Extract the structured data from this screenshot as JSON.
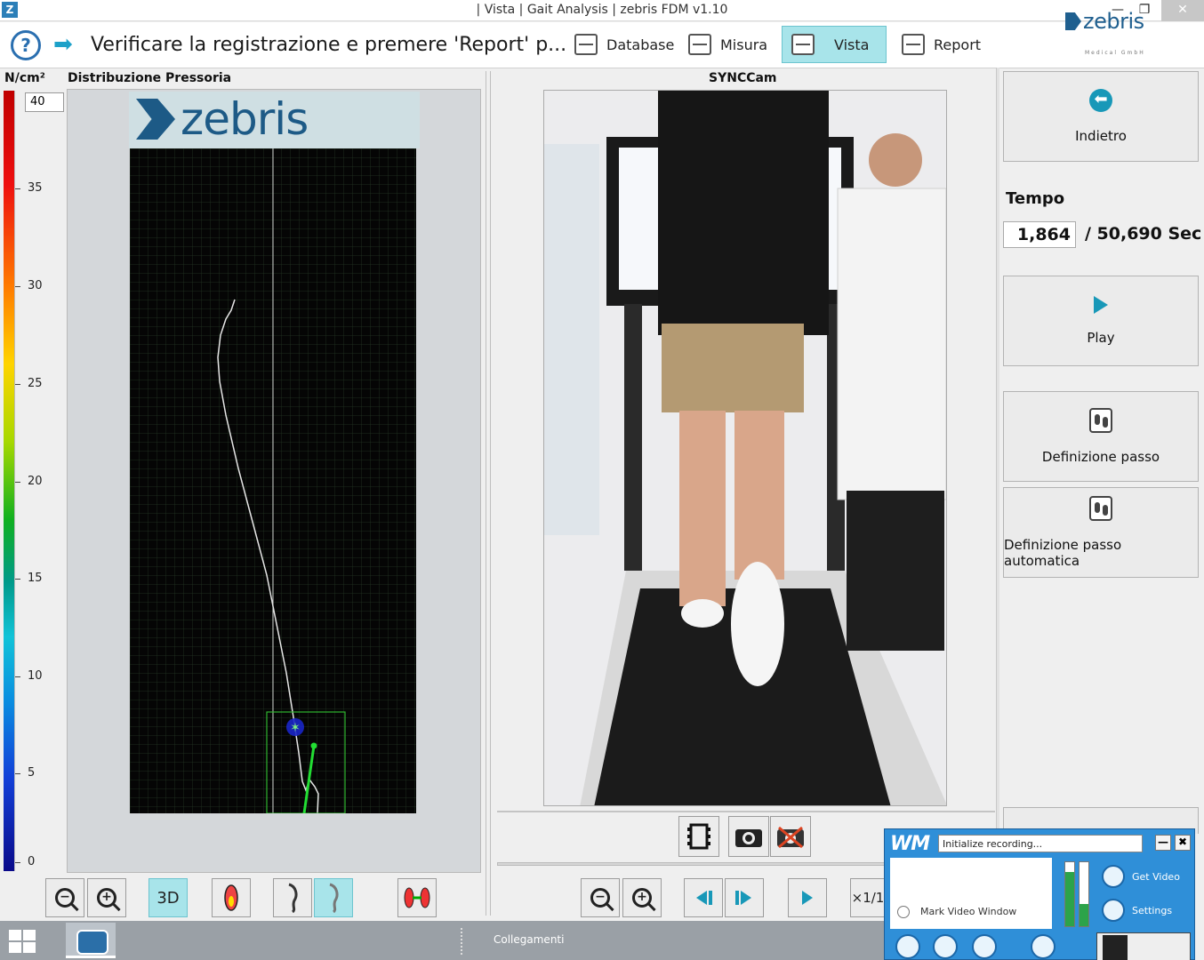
{
  "window": {
    "title": "| Vista | Gait Analysis | zebris FDM v1.10",
    "min_glyph": "—",
    "max_glyph": "❐",
    "close_glyph": "✕"
  },
  "toolbar": {
    "help_glyph": "?",
    "arrow_glyph": "➡",
    "instruction": "Verificare la registrazione e premere 'Report' p...",
    "buttons": [
      {
        "label": "Database",
        "icon": "database-icon"
      },
      {
        "label": "Misura",
        "icon": "measure-icon"
      },
      {
        "label": "Vista",
        "icon": "view-icon",
        "active": true
      },
      {
        "label": "Report",
        "icon": "report-icon"
      }
    ],
    "brand": "zebris",
    "brand_sub": "Medical GmbH"
  },
  "pressure": {
    "unit": "N/cm²",
    "title": "Distribuzione Pressoria",
    "max_value": "40",
    "scale_labels": [
      "35",
      "30",
      "25",
      "20",
      "15",
      "10",
      "5",
      "0"
    ],
    "banner_text": "zebris"
  },
  "left_tools": {
    "zoom_out": "−",
    "zoom_in": "+",
    "btn_3d": "3D",
    "swap_glyph": "⇄"
  },
  "camera": {
    "title": "SYNCCam"
  },
  "video_tools": {
    "speed_label": "×1/1"
  },
  "side_panel": {
    "back_label": "Indietro",
    "back_glyph": "⬅",
    "tempo_label": "Tempo",
    "time_current": "1,864",
    "time_total": "/ 50,690 Sec",
    "play_label": "Play",
    "step_def_label": "Definizione passo",
    "auto_step_label": "Definizione passo automatica"
  },
  "recorder": {
    "logo": "WM",
    "status": "Initialize recording...",
    "min_glyph": "—",
    "close_glyph": "✖",
    "mark_window": "Mark Video Window",
    "get_video": "Get Video",
    "settings": "Settings",
    "level_left": 0.85,
    "level_right": 0.35
  },
  "taskbar": {
    "links_label": "Collegamenti"
  },
  "colors": {
    "accent_active": "#a8e4ea",
    "brand_blue": "#1d5a86",
    "plate_bg": "#050505",
    "trace_green": "#22dd33"
  }
}
